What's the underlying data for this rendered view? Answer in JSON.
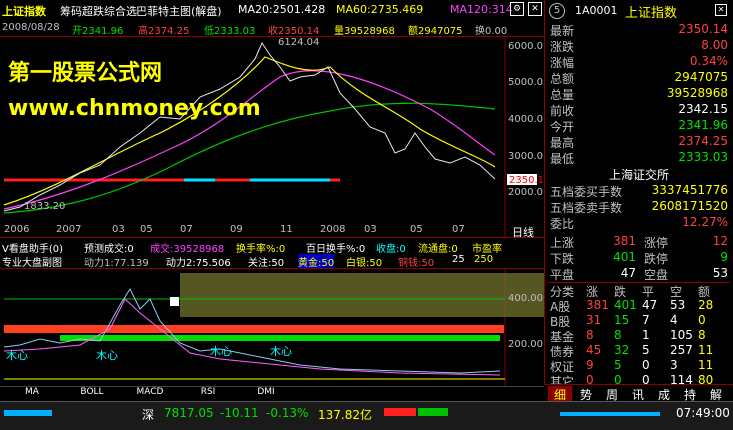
{
  "header": {
    "index_name": "上证指数",
    "indicator_name": "筹码超跌综合选",
    "chart_name": "巴菲特主图(解盘)",
    "ma20": "MA20:2501.428",
    "ma60": "MA60:2735.469",
    "ma120": "MA120:314"
  },
  "info": {
    "date": "2008/08/28",
    "open": "开2341.96",
    "high": "高2374.25",
    "low": "低2333.03",
    "close": "收2350.14",
    "volume": "量39528968",
    "amount": "额2947075",
    "turnover": "换0.00"
  },
  "watermark": {
    "line1": "第一股票公式网",
    "line2": "www.chnmoney.com"
  },
  "main_chart": {
    "y_ticks": [
      "6000.0",
      "5000.0",
      "4000.0",
      "3000.0",
      "2000.0"
    ],
    "peak_label": "6124.04",
    "trough_label": "1833.20",
    "last_price_label": "2350.1",
    "x_labels": [
      "2006",
      "2007",
      "03",
      "05",
      "07",
      "09",
      "11",
      "2008",
      "03",
      "05",
      "07"
    ],
    "period_label": "日线"
  },
  "sub1": {
    "title": "V看盘助手(0)",
    "fields": [
      "预测成交:0",
      "成交:39528968",
      "换手率%:0",
      "百日换手%:0",
      "收盘:0",
      "流通盘:0",
      "市盈率"
    ]
  },
  "sub2": {
    "title": "专业大盘副图",
    "fields": [
      "动力1:77.139",
      "动力2:75.506",
      "关注:50",
      "黄金:50",
      "白银:50",
      "铜钱:50",
      "25",
      "250"
    ],
    "y_ticks": [
      "400.00",
      "200.00"
    ],
    "labels": [
      "木心",
      "木心",
      "木心",
      "木心"
    ]
  },
  "bottom_tabs": [
    "MA",
    "BOLL",
    "MACD",
    "RSI",
    "DMI"
  ],
  "status_bar": {
    "market": "深",
    "index_value": "7817.05",
    "change": "-10.11",
    "change_pct": "-0.13%",
    "amount": "137.82亿",
    "time": "07:49:00"
  },
  "right_panel": {
    "number_badge": "5",
    "code": "1A0001",
    "name": "上证指数",
    "quote_rows": [
      {
        "label": "最新",
        "value": "2350.14",
        "color": "#ff4040"
      },
      {
        "label": "涨跌",
        "value": "8.00",
        "color": "#ff4040"
      },
      {
        "label": "涨幅",
        "value": "0.34%",
        "color": "#ff4040"
      },
      {
        "label": "总额",
        "value": "2947075",
        "color": "#ffff00"
      },
      {
        "label": "总量",
        "value": "39528968",
        "color": "#ffff00"
      },
      {
        "label": "前收",
        "value": "2342.15",
        "color": "#ffffff"
      },
      {
        "label": "今开",
        "value": "2341.96",
        "color": "#00e000"
      },
      {
        "label": "最高",
        "value": "2374.25",
        "color": "#ff4040"
      },
      {
        "label": "最低",
        "value": "2333.03",
        "color": "#00e000"
      }
    ],
    "exchange": "上海证交所",
    "order_rows": [
      {
        "label": "五档委买手数",
        "value": "3337451776",
        "color": "#ffff00"
      },
      {
        "label": "五档委卖手数",
        "value": "2608171520",
        "color": "#ffff00"
      },
      {
        "label": "委比",
        "value": "12.27%",
        "color": "#ff4040"
      }
    ],
    "breadth_rows": [
      {
        "l1": "上涨",
        "v1": "381",
        "l2": "涨停",
        "v2": "12",
        "c1": "#ff4040",
        "c2": "#ff4040"
      },
      {
        "l1": "下跌",
        "v1": "401",
        "l2": "跌停",
        "v2": "9",
        "c1": "#00e000",
        "c2": "#00e000"
      },
      {
        "l1": "平盘",
        "v1": "47",
        "l2": "空盘",
        "v2": "53",
        "c1": "#ffffff",
        "c2": "#ffffff"
      }
    ],
    "table_header": [
      "分类",
      "涨",
      "跌",
      "平",
      "空",
      "额"
    ],
    "table_rows": [
      [
        "A股",
        "381",
        "401",
        "47",
        "53",
        "28"
      ],
      [
        "B股",
        "31",
        "15",
        "7",
        "4",
        "0"
      ],
      [
        "基金",
        "8",
        "8",
        "1",
        "105",
        "8"
      ],
      [
        "债券",
        "45",
        "32",
        "5",
        "257",
        "11"
      ],
      [
        "权证",
        "9",
        "5",
        "0",
        "3",
        "11"
      ],
      [
        "其它",
        "0",
        "0",
        "0",
        "114",
        "80"
      ]
    ],
    "tabs": [
      "细",
      "势",
      "周",
      "讯",
      "成",
      "持",
      "解"
    ]
  }
}
